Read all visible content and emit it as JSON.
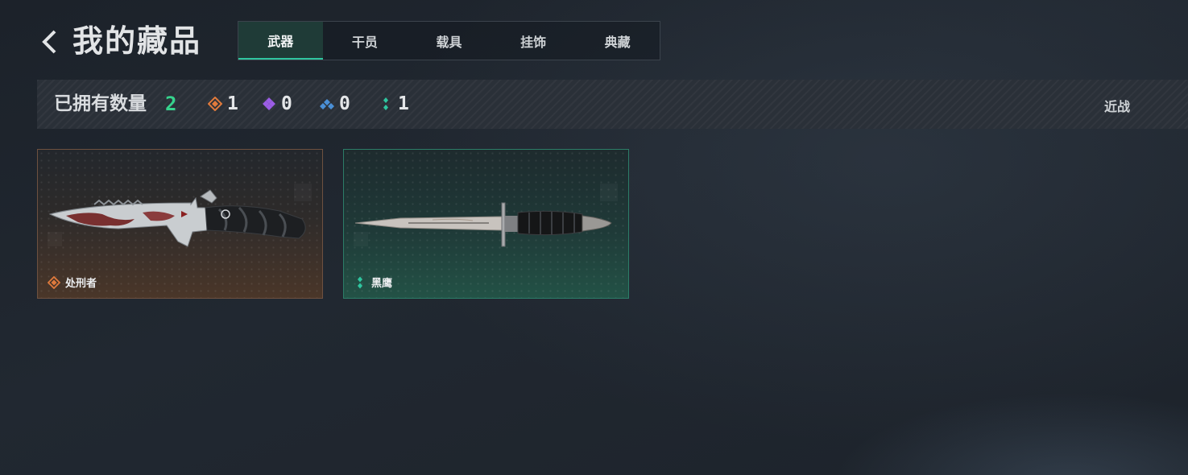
{
  "header": {
    "title": "我的藏品",
    "tabs": [
      {
        "label": "武器",
        "active": true
      },
      {
        "label": "干员",
        "active": false
      },
      {
        "label": "载具",
        "active": false
      },
      {
        "label": "挂饰",
        "active": false
      },
      {
        "label": "典藏",
        "active": false
      }
    ]
  },
  "stats": {
    "owned_label": "已拥有数量",
    "owned_count": "2",
    "rarities": [
      {
        "icon": "orange-diamond-icon",
        "color": "#e07a3c",
        "count": "1"
      },
      {
        "icon": "purple-diamond-icon",
        "color": "#9b5de5",
        "count": "0"
      },
      {
        "icon": "blue-diamond-icon",
        "color": "#4a8fd6",
        "count": "0"
      },
      {
        "icon": "green-dots-icon",
        "color": "#2fc6a0",
        "count": "1"
      }
    ],
    "filter_label": "近战"
  },
  "items": [
    {
      "name": "处刑者",
      "rarity_icon": "orange-diamond-icon",
      "rarity_color": "#e07a3c"
    },
    {
      "name": "黑鹰",
      "rarity_icon": "green-dots-icon",
      "rarity_color": "#2fc6a0"
    }
  ],
  "colors": {
    "accent": "#2fc6a0",
    "count_green": "#36d38d",
    "background": "#1f252d"
  }
}
